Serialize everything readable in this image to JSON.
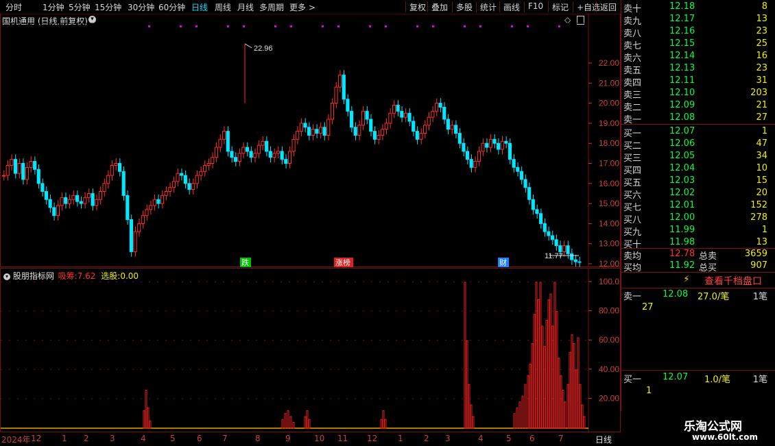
{
  "toolbar": {
    "periods": [
      "分时",
      "1分钟",
      "5分钟",
      "15分钟",
      "30分钟",
      "60分钟",
      "日线",
      "周线",
      "月线",
      "多周期",
      "更多 >"
    ],
    "active_period": "日线",
    "actions": [
      "复权",
      "叠加",
      "多股",
      "统计",
      "画线",
      "F10",
      "标记",
      "+自选",
      "返回"
    ]
  },
  "main": {
    "title": "国机通用 (日线,前复权)",
    "high_marker": "22.96",
    "low_marker": "11.77",
    "event_tags": [
      {
        "label": "跌",
        "color": "#00c000"
      },
      {
        "label": "涨榜",
        "color": "#e02020"
      },
      {
        "label": "财",
        "color": "#2080ff"
      }
    ],
    "y_ticks": [
      "22.00",
      "21.00",
      "20.00",
      "19.00",
      "18.00",
      "17.00",
      "16.00",
      "15.00",
      "14.00",
      "13.00",
      "12.00"
    ]
  },
  "sub": {
    "indicator_name": "股朋指标网",
    "series1_label": "吸筹:",
    "series1_value": "7.62",
    "series2_label": "选股:",
    "series2_value": "0.00",
    "y_ticks": [
      "100.0",
      "80.00",
      "60.00",
      "40.00",
      "20.00"
    ]
  },
  "time_axis": {
    "labels": [
      "2024年",
      "12",
      "1",
      "2",
      "3",
      "4",
      "5",
      "6",
      "7",
      "8",
      "9",
      "10",
      "11",
      "12",
      "1",
      "2",
      "3",
      "4",
      "5",
      "6",
      "7"
    ],
    "period_label": "日线"
  },
  "orderbook": {
    "asks": [
      {
        "label": "卖十",
        "price": "12.18",
        "vol": "8"
      },
      {
        "label": "卖九",
        "price": "12.17",
        "vol": "13"
      },
      {
        "label": "卖八",
        "price": "12.16",
        "vol": "23"
      },
      {
        "label": "卖七",
        "price": "12.15",
        "vol": "25"
      },
      {
        "label": "卖六",
        "price": "12.14",
        "vol": "16"
      },
      {
        "label": "卖五",
        "price": "12.13",
        "vol": "23"
      },
      {
        "label": "卖四",
        "price": "12.11",
        "vol": "31"
      },
      {
        "label": "卖三",
        "price": "12.10",
        "vol": "203"
      },
      {
        "label": "卖二",
        "price": "12.09",
        "vol": "21"
      },
      {
        "label": "卖一",
        "price": "12.08",
        "vol": "27"
      }
    ],
    "bids": [
      {
        "label": "买一",
        "price": "12.07",
        "vol": "1"
      },
      {
        "label": "买二",
        "price": "12.06",
        "vol": "47"
      },
      {
        "label": "买三",
        "price": "12.05",
        "vol": "34"
      },
      {
        "label": "买四",
        "price": "12.04",
        "vol": "10"
      },
      {
        "label": "买五",
        "price": "12.03",
        "vol": "15"
      },
      {
        "label": "买六",
        "price": "12.02",
        "vol": "20"
      },
      {
        "label": "买七",
        "price": "12.01",
        "vol": "152"
      },
      {
        "label": "买八",
        "price": "12.00",
        "vol": "278"
      },
      {
        "label": "买九",
        "price": "11.99",
        "vol": "1"
      },
      {
        "label": "买十",
        "price": "11.98",
        "vol": "13"
      }
    ],
    "sell_avg_label": "卖均",
    "sell_avg": "12.78",
    "total_sell_label": "总卖",
    "total_sell": "3659",
    "buy_avg_label": "买均",
    "buy_avg": "11.92",
    "total_buy_label": "总买",
    "total_buy": "907",
    "view_button": "查看千档盘口",
    "best_ask": {
      "label": "卖一",
      "price": "12.08",
      "size": "27.0/笔",
      "count": "1笔",
      "sub": "27"
    },
    "best_bid": {
      "label": "买一",
      "price": "12.07",
      "size": "1.0/笔",
      "count": "1笔",
      "sub": "1"
    }
  },
  "watermark": {
    "line1": "乐淘公式网",
    "line2": "www.60lt.com"
  },
  "colors": {
    "up": "#ff3030",
    "down": "#00e8ff",
    "grid": "#7a1010",
    "accent": "#e000e0"
  }
}
